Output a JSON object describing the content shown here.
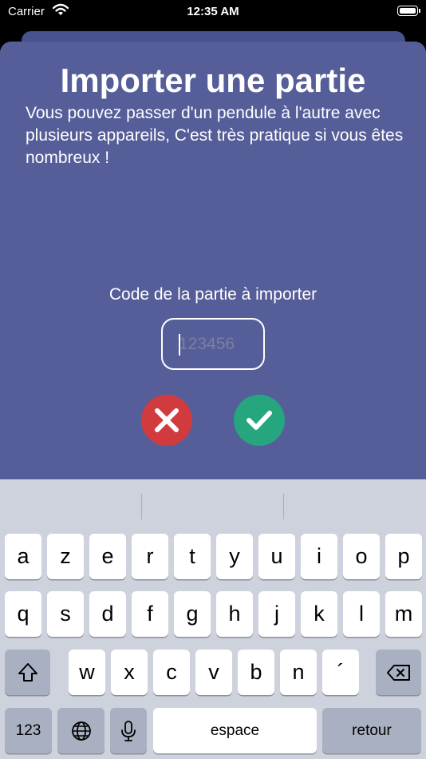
{
  "status_bar": {
    "carrier": "Carrier",
    "time": "12:35 AM"
  },
  "sheet": {
    "title": "Importer une partie",
    "description": "Vous pouvez passer d'un pendule à l'autre avec plusieurs appareils, C'est très pratique si vous êtes nombreux !",
    "code_label": "Code de la partie à importer",
    "code_input": {
      "value": "",
      "placeholder": "123456"
    },
    "cancel_icon": "close-icon",
    "confirm_icon": "check-icon"
  },
  "colors": {
    "sheet_background": "#555e99",
    "cancel": "#d13b3e",
    "confirm": "#26a67f",
    "keyboard_background": "#ced2dc"
  },
  "keyboard": {
    "row1": [
      "a",
      "z",
      "e",
      "r",
      "t",
      "y",
      "u",
      "i",
      "o",
      "p"
    ],
    "row2": [
      "q",
      "s",
      "d",
      "f",
      "g",
      "h",
      "j",
      "k",
      "l",
      "m"
    ],
    "row3": [
      "w",
      "x",
      "c",
      "v",
      "b",
      "n",
      "´"
    ],
    "shift_icon": "shift-icon",
    "backspace_icon": "backspace-icon",
    "numbers_label": "123",
    "globe_icon": "globe-icon",
    "mic_icon": "microphone-icon",
    "space_label": "espace",
    "return_label": "retour"
  }
}
